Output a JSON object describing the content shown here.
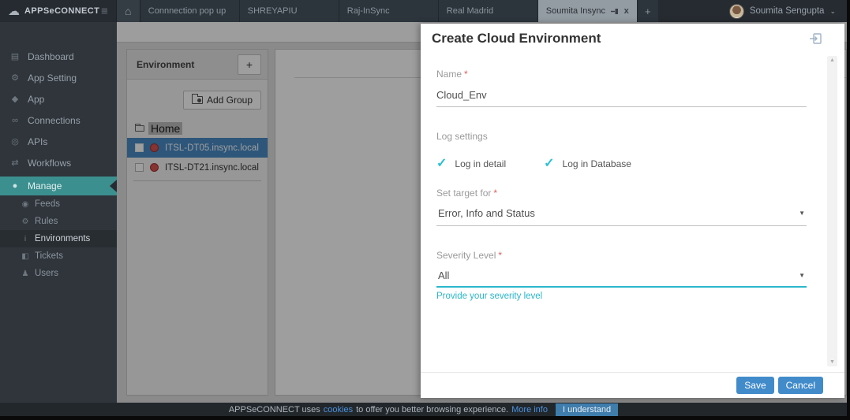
{
  "topbar": {
    "brand": "APPSeCONNECT",
    "hamburger_glyph": "≡",
    "home_glyph": "⌂",
    "tabs": [
      {
        "label": "Connnection pop up",
        "active": false
      },
      {
        "label": "SHREYAPIU",
        "active": false
      },
      {
        "label": "Raj-InSync",
        "active": false
      },
      {
        "label": "Real Madrid",
        "active": false
      },
      {
        "label": "Soumita Insync",
        "active": true
      }
    ],
    "close_glyph": "x",
    "new_tab_label": "+",
    "user_name": "Soumita Sengupta"
  },
  "sidebar": {
    "items": [
      {
        "label": "Dashboard",
        "glyph": "▤"
      },
      {
        "label": "App Setting",
        "glyph": "⚙"
      },
      {
        "label": "App",
        "glyph": "◆"
      },
      {
        "label": "Connections",
        "glyph": "∞"
      },
      {
        "label": "APIs",
        "glyph": "◎"
      },
      {
        "label": "Workflows",
        "glyph": "⇄"
      },
      {
        "label": "Manage",
        "glyph": "●"
      }
    ],
    "manage_children": [
      {
        "label": "Feeds",
        "glyph": "◉"
      },
      {
        "label": "Rules",
        "glyph": "⚙"
      },
      {
        "label": "Environments",
        "glyph": "i"
      },
      {
        "label": "Tickets",
        "glyph": "◧"
      },
      {
        "label": "Users",
        "glyph": "♟"
      }
    ]
  },
  "environment_panel": {
    "title": "Environment",
    "add_button_label": "+",
    "add_group_label": "Add Group",
    "root_label": "Home",
    "nodes": [
      {
        "label": "ITSL-DT05.insync.local",
        "selected": true
      },
      {
        "label": "ITSL-DT21.insync.local",
        "selected": false
      }
    ]
  },
  "modal": {
    "title": "Create Cloud Environment",
    "required_marker": "*",
    "name_label": "Name",
    "name_value": "Cloud_Env",
    "log_settings_label": "Log settings",
    "checkmark_glyph": "✓",
    "checkboxes": [
      {
        "label": "Log in detail",
        "checked": true
      },
      {
        "label": "Log in Database",
        "checked": true
      }
    ],
    "target_label": "Set target for",
    "target_value": "Error, Info and Status",
    "severity_label": "Severity Level",
    "severity_value": "All",
    "severity_hint": "Provide your severity level",
    "save_label": "Save",
    "cancel_label": "Cancel"
  },
  "cookie_bar": {
    "text_before": "APPSeCONNECT uses",
    "cookies_link": "cookies",
    "text_middle": "to offer you better browsing experience.",
    "more_info_link": "More info",
    "accept_label": "I understand"
  },
  "colors": {
    "accent_teal": "#3c8f8f",
    "primary_blue": "#428bca",
    "check_cyan": "#2bc0d4",
    "required_red": "#e05c5c",
    "status_dot_red": "#d9534f",
    "topbar_bg": "#262b31",
    "sidebar_bg": "#2f353b"
  }
}
